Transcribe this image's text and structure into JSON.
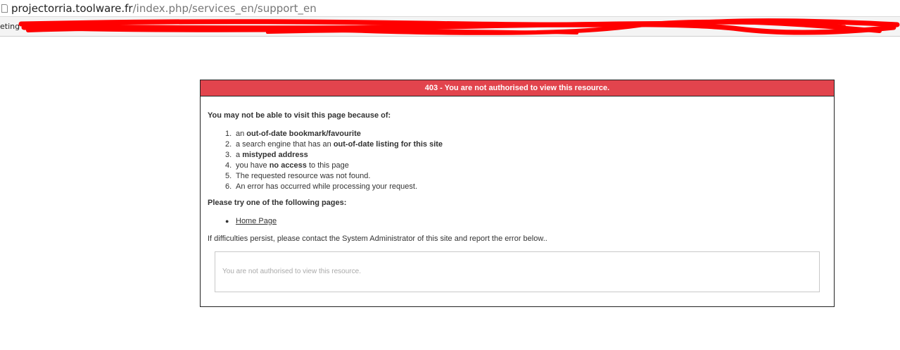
{
  "browser": {
    "url_host": "projectorria.toolware.fr",
    "url_path": "/index.php/services_en/support_en",
    "bookmark_partial_label": "eting"
  },
  "error": {
    "header": "403 - You are not authorised to view this resource.",
    "intro": "You may not be able to visit this page because of:",
    "reasons": [
      {
        "num": "1.",
        "pre": "an ",
        "bold": "out-of-date bookmark/favourite",
        "post": ""
      },
      {
        "num": "2.",
        "pre": "a search engine that has an ",
        "bold": "out-of-date listing for this site",
        "post": ""
      },
      {
        "num": "3.",
        "pre": "a ",
        "bold": "mistyped address",
        "post": ""
      },
      {
        "num": "4.",
        "pre": "you have ",
        "bold": "no access",
        "post": " to this page"
      },
      {
        "num": "5.",
        "pre": "The requested resource was not found.",
        "bold": "",
        "post": ""
      },
      {
        "num": "6.",
        "pre": "An error has occurred while processing your request.",
        "bold": "",
        "post": ""
      }
    ],
    "try_heading": "Please try one of the following pages:",
    "home_link": "Home Page",
    "persist_text": "If difficulties persist, please contact the System Administrator of this site and report the error below..",
    "detail_message": "You are not authorised to view this resource."
  },
  "colors": {
    "header_bg": "#e2444d",
    "redaction": "#ff0000"
  }
}
